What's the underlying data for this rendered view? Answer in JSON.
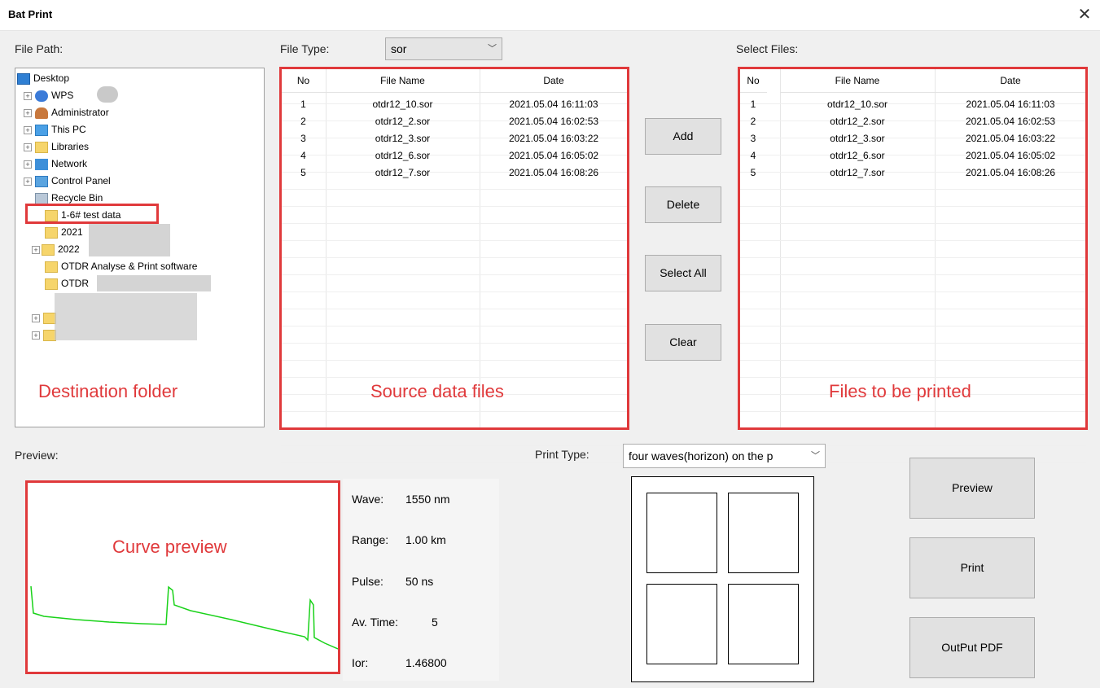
{
  "window": {
    "title": "Bat Print",
    "close_glyph": "✕"
  },
  "labels": {
    "file_path": "File Path:",
    "file_type": "File Type:",
    "select_files": "Select Files:",
    "preview": "Preview:",
    "print_type": "Print Type:"
  },
  "file_type": {
    "value": "sor"
  },
  "print_type": {
    "value": "four waves(horizon) on the p"
  },
  "tree": {
    "items": [
      {
        "label": "Desktop",
        "icon": "desktop-icon"
      },
      {
        "label": "WPS",
        "icon": "cloud-icon"
      },
      {
        "label": "Administrator",
        "icon": "user-icon"
      },
      {
        "label": "This PC",
        "icon": "computer-icon"
      },
      {
        "label": "Libraries",
        "icon": "library-icon"
      },
      {
        "label": "Network",
        "icon": "network-icon"
      },
      {
        "label": "Control Panel",
        "icon": "control-panel-icon"
      },
      {
        "label": "Recycle Bin",
        "icon": "recycle-bin-icon"
      },
      {
        "label": "1-6# test data",
        "icon": "folder-icon"
      },
      {
        "label": "2021",
        "icon": "folder-icon"
      },
      {
        "label": "2022",
        "icon": "folder-icon"
      },
      {
        "label": "OTDR Analyse & Print software",
        "icon": "folder-icon"
      },
      {
        "label": "OTDR",
        "icon": "folder-icon"
      }
    ]
  },
  "table_headers": {
    "no": "No",
    "file_name": "File Name",
    "date": "Date"
  },
  "source_files": [
    {
      "no": "1",
      "name": "otdr12_10.sor",
      "date": "2021.05.04  16:11:03"
    },
    {
      "no": "2",
      "name": "otdr12_2.sor",
      "date": "2021.05.04  16:02:53"
    },
    {
      "no": "3",
      "name": "otdr12_3.sor",
      "date": "2021.05.04  16:03:22"
    },
    {
      "no": "4",
      "name": "otdr12_6.sor",
      "date": "2021.05.04  16:05:02"
    },
    {
      "no": "5",
      "name": "otdr12_7.sor",
      "date": "2021.05.04  16:08:26"
    }
  ],
  "selected_files": [
    {
      "no": "1",
      "name": "otdr12_10.sor",
      "date": "2021.05.04  16:11:03"
    },
    {
      "no": "2",
      "name": "otdr12_2.sor",
      "date": "2021.05.04  16:02:53"
    },
    {
      "no": "3",
      "name": "otdr12_3.sor",
      "date": "2021.05.04  16:03:22"
    },
    {
      "no": "4",
      "name": "otdr12_6.sor",
      "date": "2021.05.04  16:05:02"
    },
    {
      "no": "5",
      "name": "otdr12_7.sor",
      "date": "2021.05.04  16:08:26"
    }
  ],
  "buttons": {
    "add": "Add",
    "delete": "Delete",
    "select_all": "Select All",
    "clear": "Clear",
    "preview": "Preview",
    "print": "Print",
    "output_pdf": "OutPut PDF"
  },
  "annotations": {
    "destination": "Destination folder",
    "source": "Source data files",
    "printed": "Files to be printed",
    "curve": "Curve preview"
  },
  "info": {
    "wave_label": "Wave:",
    "wave_value": "1550 nm",
    "range_label": "Range:",
    "range_value": "1.00 km",
    "pulse_label": "Pulse:",
    "pulse_value": "50 ns",
    "avtime_label": "Av. Time:",
    "avtime_value": "5",
    "ior_label": "Ior:",
    "ior_value": "1.46800"
  },
  "colors": {
    "highlight": "#e0393b",
    "trace": "#19d219"
  }
}
